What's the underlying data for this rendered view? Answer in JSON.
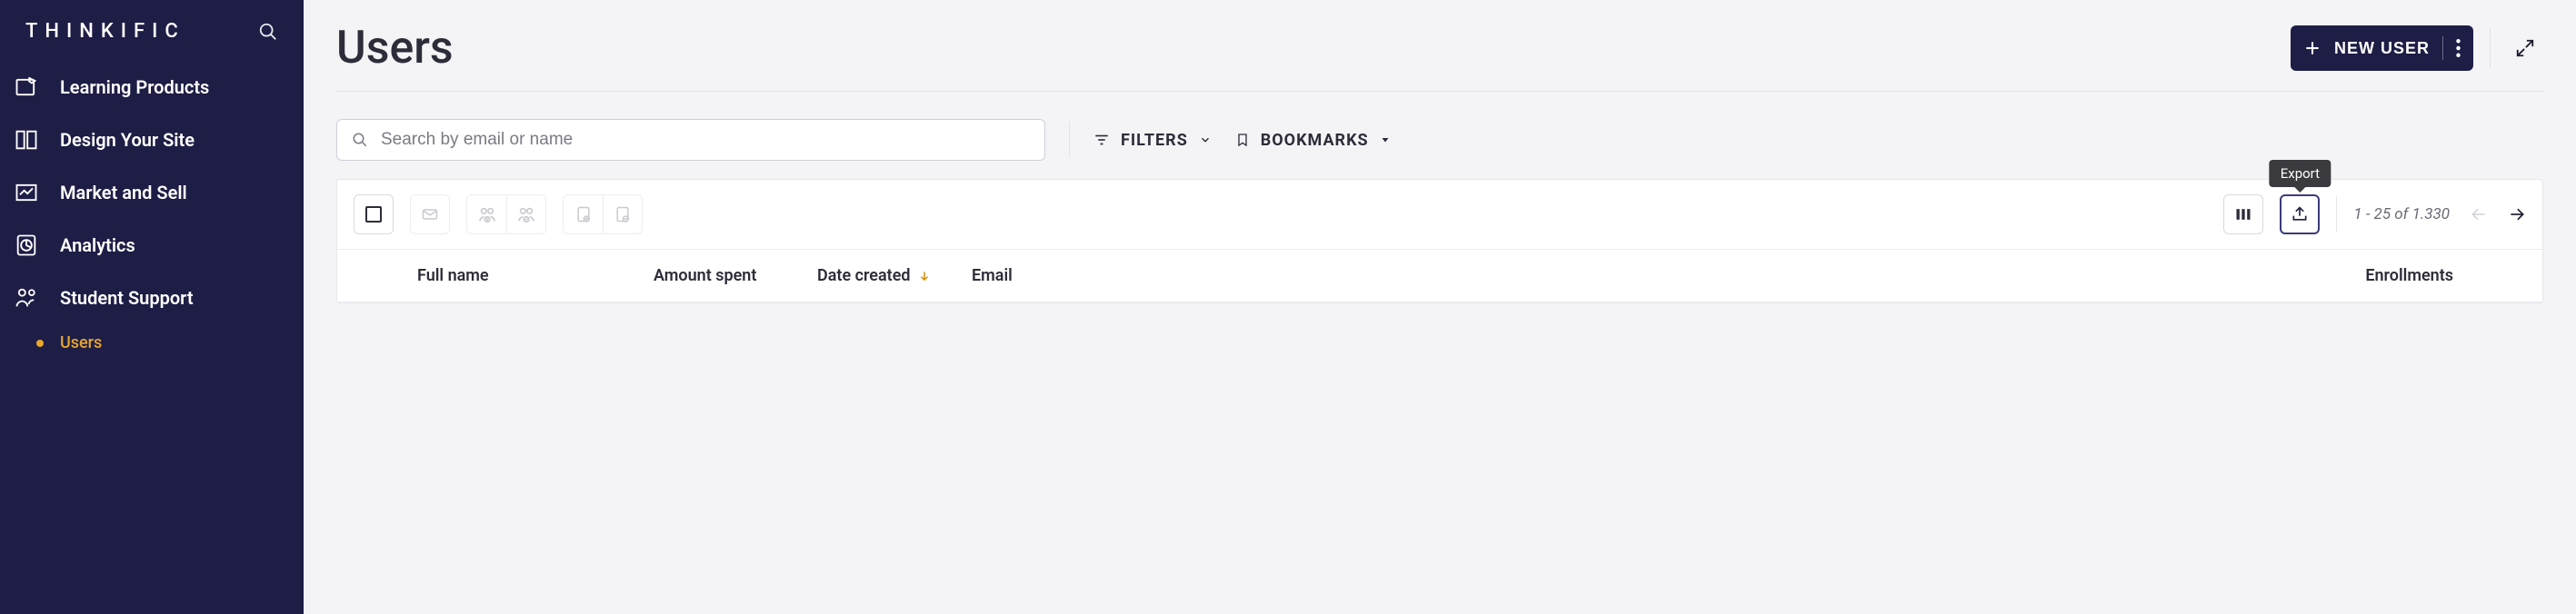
{
  "brand": "THINKIFIC",
  "sidebar": {
    "items": [
      {
        "label": "Learning Products"
      },
      {
        "label": "Design Your Site"
      },
      {
        "label": "Market and Sell"
      },
      {
        "label": "Analytics"
      },
      {
        "label": "Student Support"
      }
    ],
    "subitems": [
      {
        "label": "Users",
        "active": true
      }
    ]
  },
  "page": {
    "title": "Users",
    "new_user_label": "NEW USER"
  },
  "search": {
    "placeholder": "Search by email or name"
  },
  "toolbar": {
    "filters_label": "FILTERS",
    "bookmarks_label": "BOOKMARKS",
    "export_tooltip": "Export",
    "pagination": "1 - 25 of 1.330"
  },
  "columns": {
    "fullname": "Full name",
    "amount": "Amount spent",
    "date": "Date created",
    "email": "Email",
    "enrollments": "Enrollments"
  }
}
